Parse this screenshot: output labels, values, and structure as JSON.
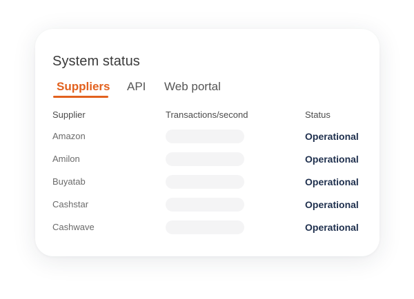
{
  "title": "System status",
  "tabs": [
    {
      "label": "Suppliers",
      "active": true
    },
    {
      "label": "API",
      "active": false
    },
    {
      "label": "Web portal",
      "active": false
    }
  ],
  "table": {
    "headers": {
      "supplier": "Supplier",
      "tps": "Transactions/second",
      "status": "Status"
    },
    "rows": [
      {
        "supplier": "Amazon",
        "status": "Operational"
      },
      {
        "supplier": "Amilon",
        "status": "Operational"
      },
      {
        "supplier": "Buyatab",
        "status": "Operational"
      },
      {
        "supplier": "Cashstar",
        "status": "Operational"
      },
      {
        "supplier": "Cashwave",
        "status": "Operational"
      }
    ]
  },
  "colors": {
    "accent": "#e2611e",
    "status_text": "#1e2f4d",
    "placeholder_bar": "#f4f4f5"
  }
}
